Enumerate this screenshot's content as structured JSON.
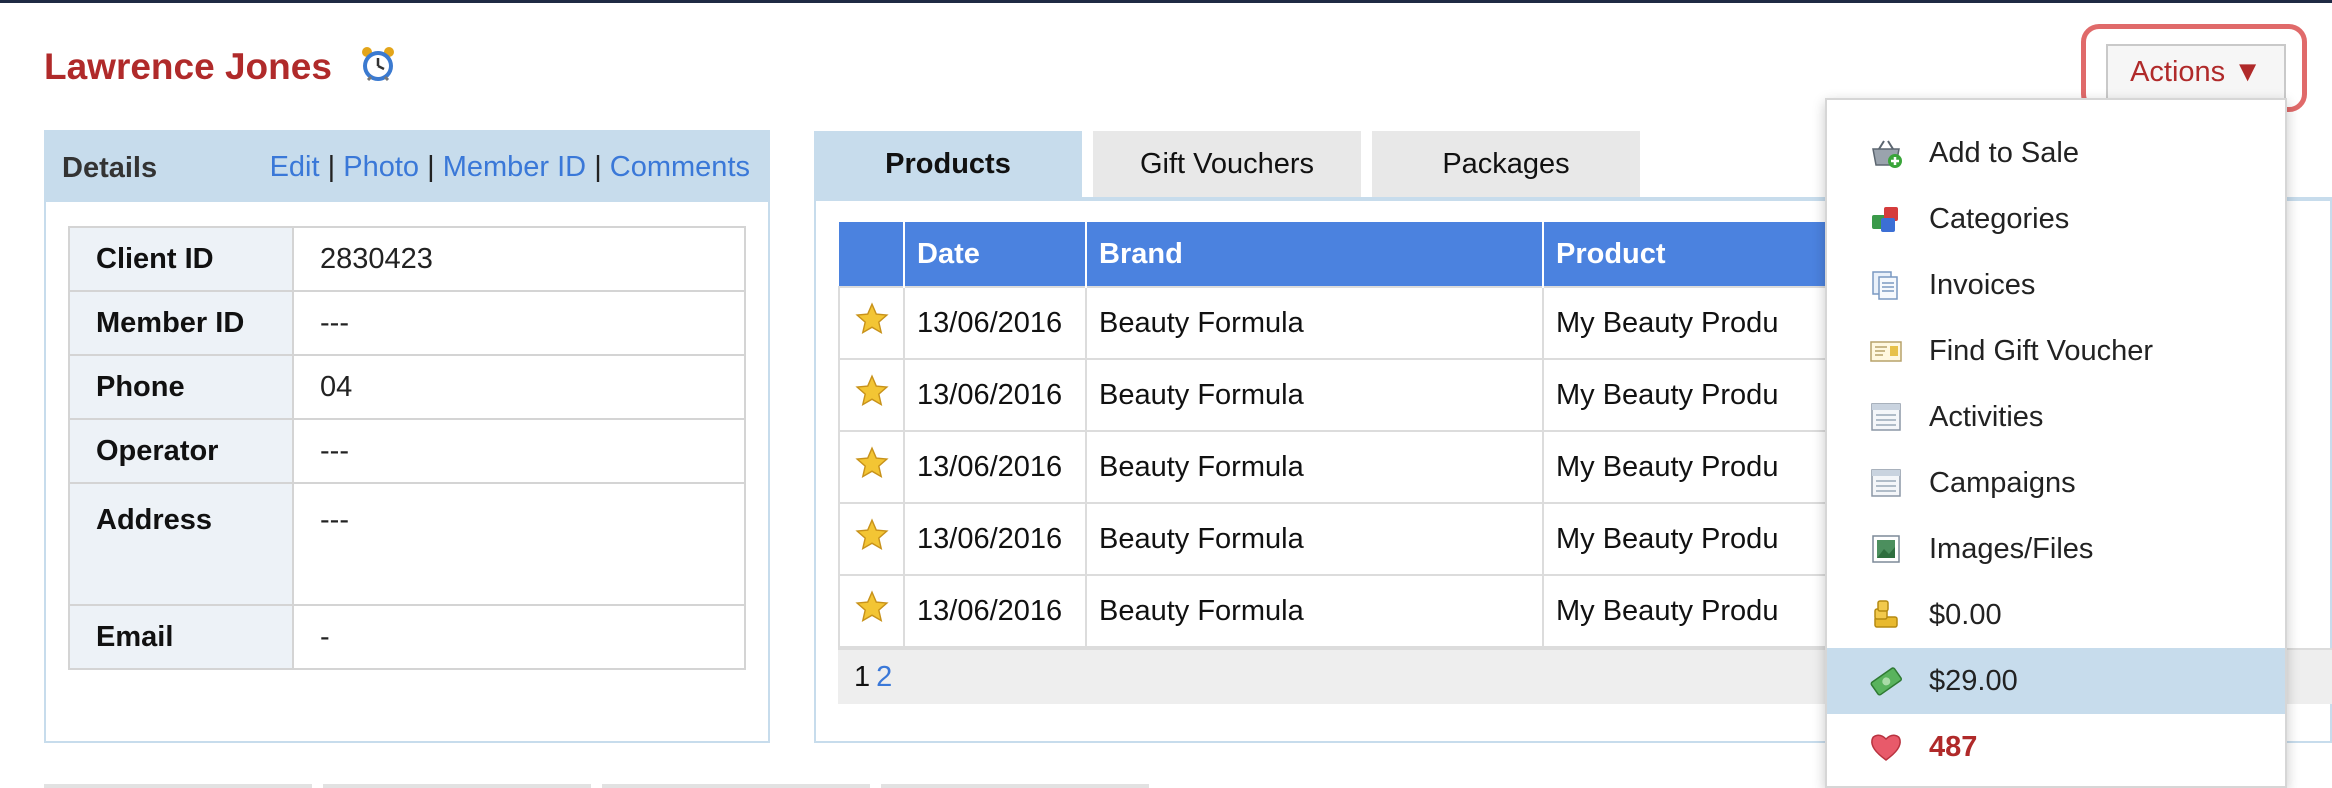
{
  "client": {
    "name": "Lawrence Jones"
  },
  "details": {
    "title": "Details",
    "links": {
      "edit": "Edit",
      "photo": "Photo",
      "member_id": "Member ID",
      "comments": "Comments",
      "separator": "|"
    },
    "rows": [
      {
        "label": "Client ID",
        "value": "2830423"
      },
      {
        "label": "Member ID",
        "value": "---"
      },
      {
        "label": "Phone",
        "value": "04"
      },
      {
        "label": "Operator",
        "value": "---"
      },
      {
        "label": "Address",
        "value": "---"
      },
      {
        "label": "Email",
        "value": "-"
      }
    ]
  },
  "tabs": [
    {
      "label": "Products",
      "active": true
    },
    {
      "label": "Gift Vouchers",
      "active": false
    },
    {
      "label": "Packages",
      "active": false
    }
  ],
  "products": {
    "columns": [
      "Date",
      "Brand",
      "Product"
    ],
    "rows": [
      {
        "date": "13/06/2016",
        "brand": "Beauty Formula",
        "product": "My Beauty Produ"
      },
      {
        "date": "13/06/2016",
        "brand": "Beauty Formula",
        "product": "My Beauty Produ"
      },
      {
        "date": "13/06/2016",
        "brand": "Beauty Formula",
        "product": "My Beauty Produ"
      },
      {
        "date": "13/06/2016",
        "brand": "Beauty Formula",
        "product": "My Beauty Produ"
      },
      {
        "date": "13/06/2016",
        "brand": "Beauty Formula",
        "product": "My Beauty Produ"
      }
    ],
    "row_icon": "star-icon",
    "pager": {
      "current": "1",
      "next": "2"
    }
  },
  "actions": {
    "button_label": "Actions ▼",
    "menu": [
      {
        "label": "Add to Sale",
        "icon": "basket-add-icon"
      },
      {
        "label": "Categories",
        "icon": "categories-icon"
      },
      {
        "label": "Invoices",
        "icon": "invoices-icon"
      },
      {
        "label": "Find Gift Voucher",
        "icon": "gift-voucher-icon"
      },
      {
        "label": "Activities",
        "icon": "activities-icon"
      },
      {
        "label": "Campaigns",
        "icon": "campaigns-icon"
      },
      {
        "label": "Images/Files",
        "icon": "image-icon"
      },
      {
        "label": "$0.00",
        "icon": "coins-icon"
      },
      {
        "label": "$29.00",
        "icon": "cash-icon",
        "selected": true
      },
      {
        "label": "487",
        "icon": "heart-icon",
        "emphasis": "red"
      }
    ]
  },
  "colors": {
    "accent_red": "#b02a2a",
    "header_blue": "#4b82df",
    "panel_blue": "#c7dcec",
    "link_blue": "#3a78d8",
    "highlight_outline": "#e06a6a"
  }
}
